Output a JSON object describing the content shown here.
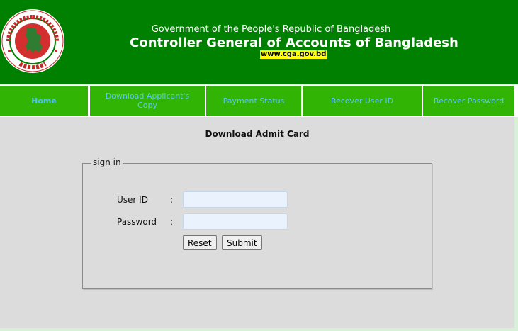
{
  "header": {
    "gov_line": "Government of the People's Republic of Bangladesh",
    "org_name": "Controller General of Accounts of Bangladesh",
    "website": "www.cga.gov.bd"
  },
  "logo": {
    "icon": "government-seal-icon"
  },
  "nav": {
    "items": [
      {
        "label": "Home"
      },
      {
        "label": "Download Applicant's Copy"
      },
      {
        "label": "Payment Status"
      },
      {
        "label": "Recover User ID"
      },
      {
        "label": "Recover Password"
      }
    ]
  },
  "main": {
    "title": "Download Admit Card",
    "signin": {
      "legend": "sign in",
      "colon": ":",
      "user_id_label": "User ID",
      "user_id_value": "",
      "password_label": "Password",
      "password_value": "",
      "reset_label": "Reset",
      "submit_label": "Submit"
    }
  },
  "colors": {
    "header_bg": "#008000",
    "nav_bg": "#31b404",
    "nav_text": "#5dc8f5",
    "url_highlight": "#ffff00",
    "content_bg": "#dcdcdc"
  }
}
